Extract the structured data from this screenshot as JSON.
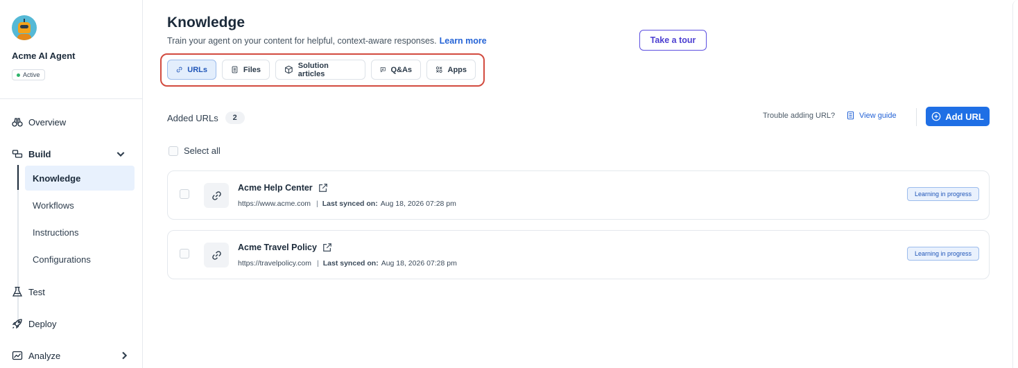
{
  "agent": {
    "name": "Acme AI Agent",
    "status": "Active",
    "status_color": "#2fb36b"
  },
  "sidebar": {
    "items": [
      {
        "label": "Overview",
        "icon": "binoculars-icon"
      },
      {
        "label": "Build",
        "icon": "blocks-icon",
        "expanded": true
      },
      {
        "label": "Test",
        "icon": "flask-icon"
      },
      {
        "label": "Deploy",
        "icon": "rocket-icon"
      },
      {
        "label": "Analyze",
        "icon": "chart-icon"
      }
    ],
    "build_subitems": [
      "Knowledge",
      "Workflows",
      "Instructions",
      "Configurations"
    ],
    "active_subitem": "Knowledge"
  },
  "header": {
    "title": "Knowledge",
    "subtitle": "Train your agent on your content for helpful, context-aware responses.",
    "learn_more": "Learn more",
    "tour_button": "Take a tour"
  },
  "tabs": [
    {
      "label": "URLs",
      "icon": "link-icon",
      "active": true
    },
    {
      "label": "Files",
      "icon": "file-icon"
    },
    {
      "label": "Solution articles",
      "icon": "cube-icon"
    },
    {
      "label": "Q&As",
      "icon": "chat-icon"
    },
    {
      "label": "Apps",
      "icon": "apps-icon"
    }
  ],
  "urls_section": {
    "added_label": "Added URLs",
    "count": "2",
    "trouble_text": "Trouble adding URL?",
    "view_guide": "View guide",
    "add_button": "Add URL",
    "select_all": "Select all"
  },
  "url_items": [
    {
      "title": "Acme Help Center",
      "url": "https://www.acme.com",
      "synced_label": "Last synced on:",
      "synced_value": "Aug 18, 2026 07:28 pm",
      "status": "Learning in progress"
    },
    {
      "title": "Acme Travel Policy",
      "url": "https://travelpolicy.com",
      "synced_label": "Last synced on:",
      "synced_value": "Aug 18, 2026 07:28 pm",
      "status": "Learning in progress"
    }
  ],
  "colors": {
    "accent": "#1f6fe5",
    "tour_border": "#5b4ee0",
    "highlight_outline": "#d24a3e"
  }
}
